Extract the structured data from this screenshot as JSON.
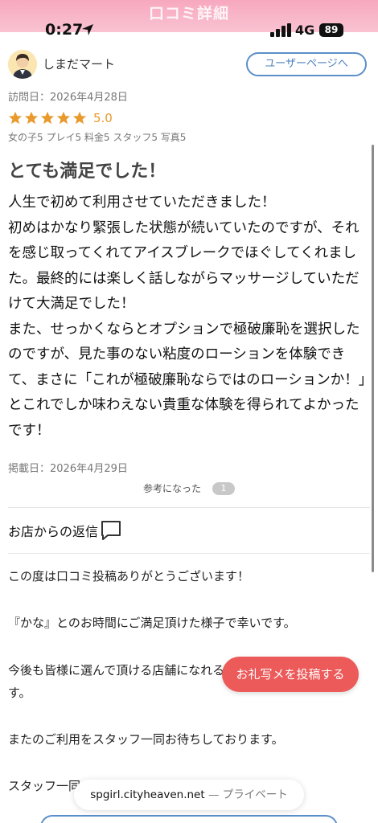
{
  "header": {
    "title": "口コミ詳細"
  },
  "status_bar": {
    "time": "0:27",
    "network": "4G",
    "battery": "89"
  },
  "reviewer": {
    "name": "しまだマート",
    "user_page_button": "ユーザーページへ"
  },
  "review": {
    "visit_date": "訪問日：2026年4月28日",
    "rating": 5,
    "score": "5.0",
    "sub_scores": "女の子5 プレイ5 料金5 スタッフ5 写真5",
    "title": "とても満足でした！",
    "body": "人生で初めて利用させていただきました！\n初めはかなり緊張した状態が続いていたのですが、それを感じ取ってくれてアイスブレークでほぐしてくれました。最終的には楽しく話しながらマッサージしていただけて大満足でした！\nまた、せっかくならとオプションで極破廉恥を選択したのですが、見た事のない粘度のローションを体験できて、まさに「これが極破廉恥ならではのローションか！」とこれでしか味わえない貴重な体験を得られてよかったです！",
    "post_date": "掲載日：2026年4月29日",
    "helpful_label": "参考になった",
    "helpful_count": "1"
  },
  "reply": {
    "heading": "お店からの返信",
    "line1": "この度は口コミ投稿ありがとうございます！",
    "line2": "『かな』とのお時間にご満足頂けた様子で幸いです。",
    "line3": "今後も皆様に選んで頂ける店舗になれるよう努めてまいりま",
    "line4": "す。",
    "line5": "またのご利用をスタッフ一同お待ちしております。",
    "line6": "スタッフ一同"
  },
  "fab_label": "お礼写メを投稿する",
  "browser": {
    "domain": "spgirl.cityheaven.net",
    "private_label": "— プライベート"
  },
  "colors": {
    "header": "#f7a8bf",
    "star": "#e89a2d",
    "accent_blue": "#5b8fc9",
    "fab": "#ec5a5a"
  },
  "icons": [
    "location-arrow-icon",
    "signal-icon",
    "star-icon",
    "chat-bubble-icon",
    "avatar-icon"
  ]
}
